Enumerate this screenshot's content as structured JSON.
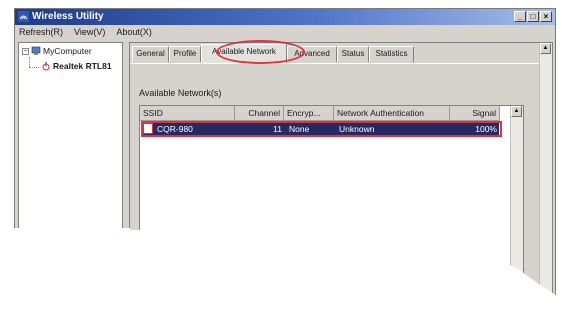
{
  "window": {
    "title": "Wireless Utility"
  },
  "menu": [
    "Refresh(R)",
    "View(V)",
    "About(X)"
  ],
  "tree": {
    "root": "MyComputer",
    "child": "Realtek RTL81"
  },
  "tabs": [
    "General",
    "Profile",
    "Available Network",
    "Advanced",
    "Status",
    "Statistics"
  ],
  "active_tab": "Available Network",
  "section_label": "Available Network(s)",
  "columns": [
    "SSID",
    "Channel",
    "Encryp...",
    "Network Authentication",
    "Signal"
  ],
  "networks": [
    {
      "ssid": "CQR-980",
      "channel": "11",
      "encryption": "None",
      "auth": "Unknown",
      "signal": "100%"
    }
  ],
  "colors": {
    "highlight": "#e0323a",
    "selection": "#262a62",
    "title_start": "#1d3b8a"
  }
}
